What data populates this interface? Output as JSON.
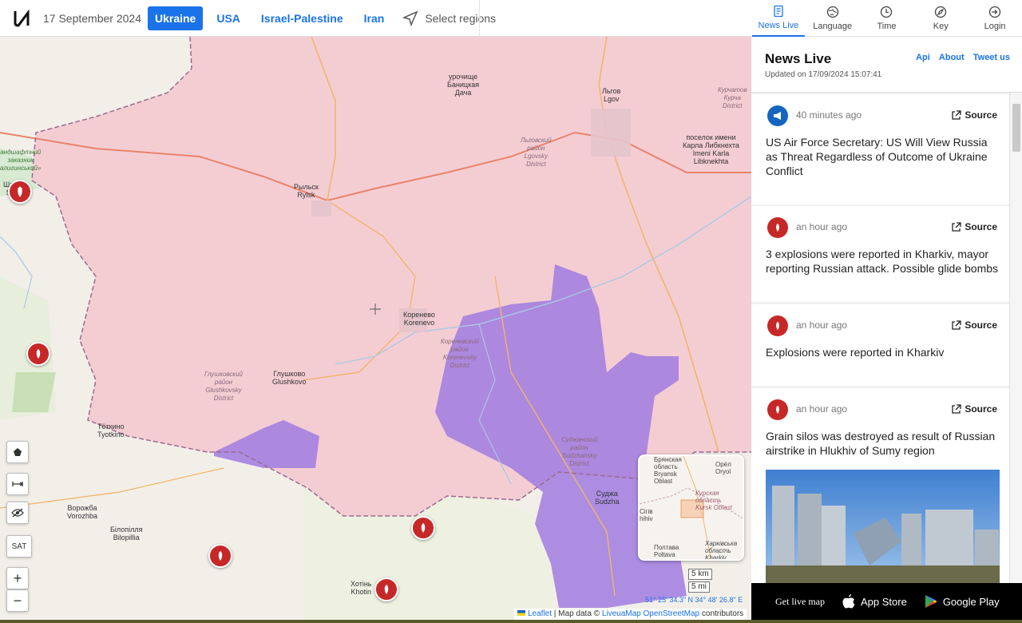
{
  "header": {
    "date": "17 September 2024",
    "tabs": [
      {
        "label": "Ukraine",
        "active": true
      },
      {
        "label": "USA",
        "active": false
      },
      {
        "label": "Israel-Palestine",
        "active": false
      },
      {
        "label": "Iran",
        "active": false
      }
    ],
    "select_regions": "Select regions"
  },
  "right_nav": [
    {
      "label": "News Live",
      "icon": "news-icon",
      "active": true
    },
    {
      "label": "Language",
      "icon": "globe-icon",
      "active": false
    },
    {
      "label": "Time",
      "icon": "clock-icon",
      "active": false
    },
    {
      "label": "Key",
      "icon": "compass-icon",
      "active": false
    },
    {
      "label": "Login",
      "icon": "login-icon",
      "active": false
    }
  ],
  "sidebar": {
    "title": "News Live",
    "links": [
      "Api",
      "About",
      "Tweet us"
    ],
    "updated": "Updated on 17/09/2024 15:07:41",
    "source_label": "Source",
    "items": [
      {
        "time": "40 minutes ago",
        "icon": "megaphone-icon",
        "text": "US Air Force Secretary: US Will View Russia as Threat Regardless of Outcome of Ukraine Conflict"
      },
      {
        "time": "an hour ago",
        "icon": "bomb-icon",
        "text": "3 explosions were reported in Kharkiv, mayor reporting Russian attack. Possible glide bombs"
      },
      {
        "time": "an hour ago",
        "icon": "bomb-icon",
        "text": "Explosions were reported in Kharkiv"
      },
      {
        "time": "an hour ago",
        "icon": "bomb-icon",
        "text": "Grain silos was destroyed as result of Russian airstrike in Hlukhiv of Sumy region"
      }
    ]
  },
  "map": {
    "labels": {
      "rylsk": "Рыльск\nRylsk",
      "lgov": "Льгов\nLgov",
      "korenevo": "Коренево\nKorenevo",
      "glushkovo": "Глушково\nGlushkovo",
      "tyotkino": "Тёткино\nTyotkino",
      "sudzha": "Суджа\nSudzha",
      "vorozhba": "Ворожба\nVorozhba",
      "bilopillia": "Білопілля\nBilopillia",
      "khotin": "Хотінь\nKhotin",
      "karla": "поселок имени\nКарла Либкнехта\nImeni Karla\nLibknekhta",
      "urochische": "урочище\nБаницкая\nДача",
      "lgovsky": "Льговский\nрайон\nLgovsky\nDistrict",
      "korenevsky": "Кореневский\nрайон\nKorenevsky\nDistrict",
      "glushkovsky": "Глушковский\nрайон\nGlushkovsky\nDistrict",
      "sudzhansky": "Суджанский\nрайон\nSudzhansky\nDistrict",
      "kurchatov": "Курчатов\nКурча\nDistrict",
      "zakaznik": "андшафтний\nзаказник\nалигинський»",
      "shalygine": "Шал   не\nSh   ne"
    },
    "controls": [
      "pentagon-icon",
      "measure-icon",
      "hide-icon",
      "SAT",
      "+",
      "−"
    ],
    "minimap": {
      "labels": [
        "Брянская\nобласть\nBryansk\nOblast",
        "Орёл\nOryol",
        "Курская\nобласть\nKursk Oblast",
        "Сігів\nhihiv",
        "Полтава\nPoltava",
        "Харківська\nобласть\nKharkiv"
      ]
    },
    "scale": [
      "5 km",
      "5 mi"
    ],
    "coords": "51° 25' 34.3\" N 34° 48' 26.8\" E",
    "attribution": {
      "leaflet": "Leaflet",
      "mid": " | Map data © ",
      "liveua": "LiveuaMap",
      "osm": "OpenStreetMap",
      "end": " contributors"
    }
  },
  "promo": {
    "get_live_map": "Get live map",
    "app_store": "App Store",
    "google_play": "Google Play"
  },
  "colors": {
    "accent": "#1a73e8",
    "russia": "#f4c9d0",
    "occupied": "#a07be0",
    "marker": "#c62828"
  }
}
